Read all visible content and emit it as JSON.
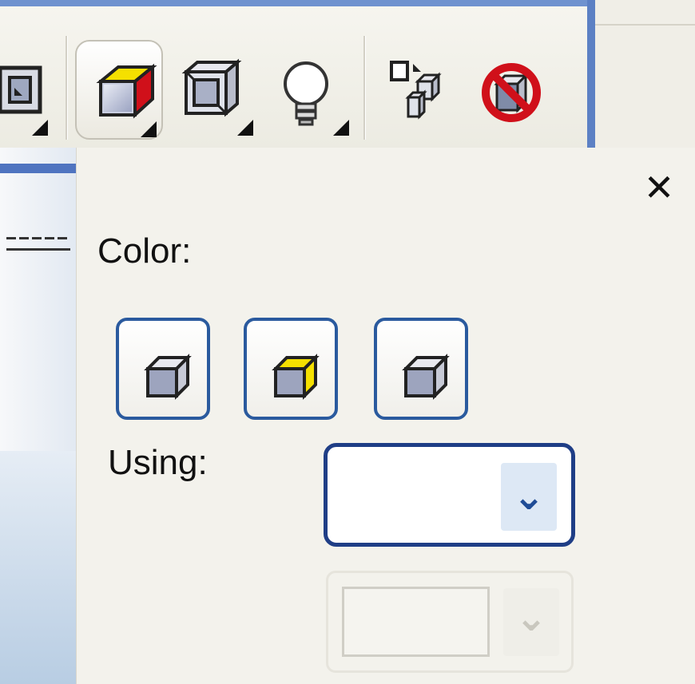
{
  "toolbar": {
    "buttons": [
      {
        "name": "bevel-effect-icon",
        "has_flyout": true
      },
      {
        "name": "extrude-color-icon",
        "has_flyout": true,
        "pressed": true
      },
      {
        "name": "bevel-depth-icon",
        "has_flyout": true
      },
      {
        "name": "lighting-bulb-icon",
        "has_flyout": true
      },
      {
        "name": "copy-extrude-properties-icon",
        "has_flyout": false
      },
      {
        "name": "clear-extrude-icon",
        "has_flyout": false
      }
    ]
  },
  "docker": {
    "close_glyph": "✕",
    "color_label": "Color:",
    "using_label": "Using:",
    "using_value": "",
    "color_options": [
      {
        "name": "use-object-fill-icon",
        "selected": false
      },
      {
        "name": "solid-fill-icon",
        "selected": true
      },
      {
        "name": "color-shading-icon",
        "selected": false
      }
    ],
    "dropdown_arrow": "⌄"
  },
  "colors": {
    "accent_blue": "#1f3e86",
    "yellow": "#f5e000",
    "red": "#d0101a"
  }
}
